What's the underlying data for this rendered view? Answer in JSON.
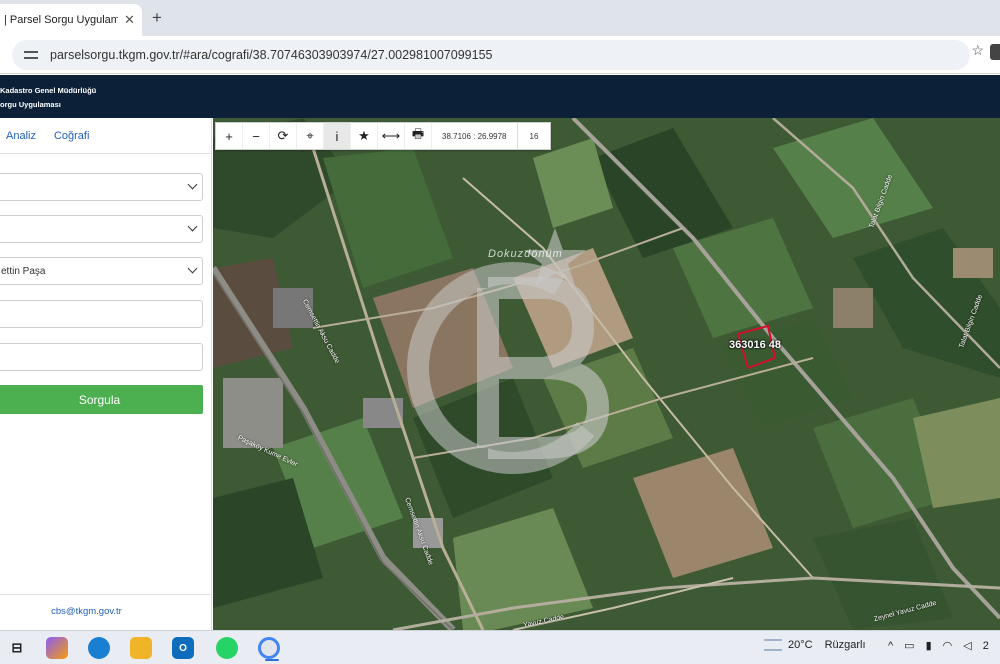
{
  "browser": {
    "tab_title": "| Parsel Sorgu Uygulaması",
    "tab_close": "✕",
    "new_tab": "+",
    "url": "parselsorgu.tkgm.gov.tr/#ara/cografi/38.70746303903974/27.002981007099155"
  },
  "app": {
    "header_line1": "Kadastro Genel Müdürlüğü",
    "header_line2": "orgu Uygulaması"
  },
  "sidebar": {
    "tabs": [
      "Analiz",
      "Coğrafi"
    ],
    "fields": {
      "il_value": "",
      "ilce_value": "",
      "mahalle_value": "ettin Paşa",
      "ada_value": "",
      "parsel_value": ""
    },
    "submit_label": "Sorgula",
    "footer_email": "cbs@tkgm.gov.tr"
  },
  "map": {
    "toolbar": {
      "zoom_in": "+",
      "zoom_out": "−",
      "refresh": "⟳",
      "locate": "⌖",
      "info": "i",
      "favorite": "★",
      "measure": "⟷",
      "print": "🖶",
      "coordinates": "38.7106 : 26.9978",
      "zoom_level": "16"
    },
    "parcel_label": "363016 48",
    "watermark_text": "Dokuzdönüm",
    "road_labels": {
      "cemsettin_1": "Cemsettin Aksu Cadde",
      "cemsettin_2": "Cemsettin Aksu Cadde",
      "pasa_evler": "Paşaköy Kume Evler",
      "talat_1": "Talat Bilgin Cadde",
      "talat_2": "Talat Bilgin Cadde",
      "zeynel": "Zeynel Yavuz Cadde",
      "yavuz": "Yavuz Cadde"
    }
  },
  "taskbar": {
    "weather_temp": "20°C",
    "weather_cond": "Rüzgarlı",
    "tray_up": "^",
    "clock_hint": "2"
  },
  "colors": {
    "header_bg": "#0c2138",
    "submit_bg": "#4caf50",
    "link": "#1f5fb8",
    "parcel_outline": "#d0102a"
  }
}
